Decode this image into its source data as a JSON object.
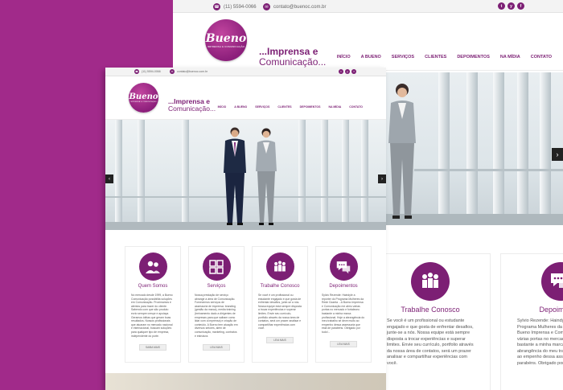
{
  "topbar": {
    "phone": "(11) 5594-0066",
    "email": "contato@buenoc.com.br",
    "social": [
      "t",
      "y",
      "f"
    ]
  },
  "brand": {
    "logo_text": "Bueno",
    "logo_tagline": "IMPRENSA & COMUNICAÇÃO",
    "slogan_line1": "...Imprensa e",
    "slogan_line2": "Comunicação..."
  },
  "nav": [
    "INÍCIO",
    "A BUENO",
    "SERVIÇOS",
    "CLIENTES",
    "DEPOIMENTOS",
    "NA MÍDIA",
    "CONTATO"
  ],
  "slider": {
    "prev": "‹",
    "next": "›"
  },
  "features": [
    {
      "icon": "group-icon",
      "title": "Quem Somos",
      "text": "No mercado desde 1999, a Bueno Comunicação possibilita soluções em Comunicação. Proximamos e atentos para trazer do cliente. Sabendo com que são produto ecrio sempre cresçe e apoiaça. Geramos idéias que geram boas resultados. Nossos profissionais que atuaram no mercado nacional e internacional, buscam soluções para qualquer tipo de empresa, independente do porte.",
      "button": "SAIBA MAIS"
    },
    {
      "icon": "grid-icon",
      "title": "Serviços",
      "text": "Nossa prestação de serviço abrange a área de Comunicação. Fornecemos serviços de assessoria de imprensa: branding (gestão da marca), media training (treinamento dado a dirigentes de empresas para que saibam como lidar com a imprensa) e criação de conteúdo. A Bueno tem atuação em diversos setores, além de comunicação, marketing, contratos e estrutura.",
      "button": "LEIA MAIS"
    },
    {
      "icon": "people-network-icon",
      "title": "Trabalhe Conosco",
      "text": "Se você é um profissional ou estudante engajado e que gosta de enfrentar desafios, junte-se a nós. Nossa equipe está sempre disposta a trocar experiências e superar limites. Envie seu currículo, portfolio através da nossa área de contatos, será um prazer analisar e compartilhar experiências com você.",
      "button": "LEIA MAIS"
    },
    {
      "icon": "chat-bubbles-icon",
      "title": "Depoimentos",
      "text": "Sylvio Rezende: Haindyle a repórter do Programa Mulheres da Rede Gazeta ...A Bueno Imprensa e Comunicação me abriu várias portas no mercado e fortaleceu bastante a minha marca profissional. Hoje a abrangência do meu trabalho se deve muito ao empenho dessa assessoria que está de parabéns. Obrigado por tudo!...",
      "button": "LEIA MAIS"
    }
  ],
  "back_cards": [
    {
      "title": "Trabalhe Conosco",
      "text": "Se você é um profissional ou estudante engajado e que gosta de enfrentar desafios, junte-se a nós. Nossa equipe está sempre disposta a trocar experiências e superar limites. Envie seu currículo, portfolio através da nossa área de contatos, será um prazer analisar e compartilhar experiências com você."
    },
    {
      "title": "Depoimentos",
      "text": "Sylvio Rezende: Haindyle a repórter do Programa Mulheres da Rede Gazeta ...A Bueno Imprensa e Comunicação me abriu várias portas no mercado e fortaleceu bastante a minha marca profissional. Hoje a abrangência do meu trabalho se deve muito ao empenho dessa assessoria que está de parabéns. Obrigado por tudo!..."
    }
  ],
  "colors": {
    "brand": "#7c1f74",
    "background": "#a12a8a"
  }
}
